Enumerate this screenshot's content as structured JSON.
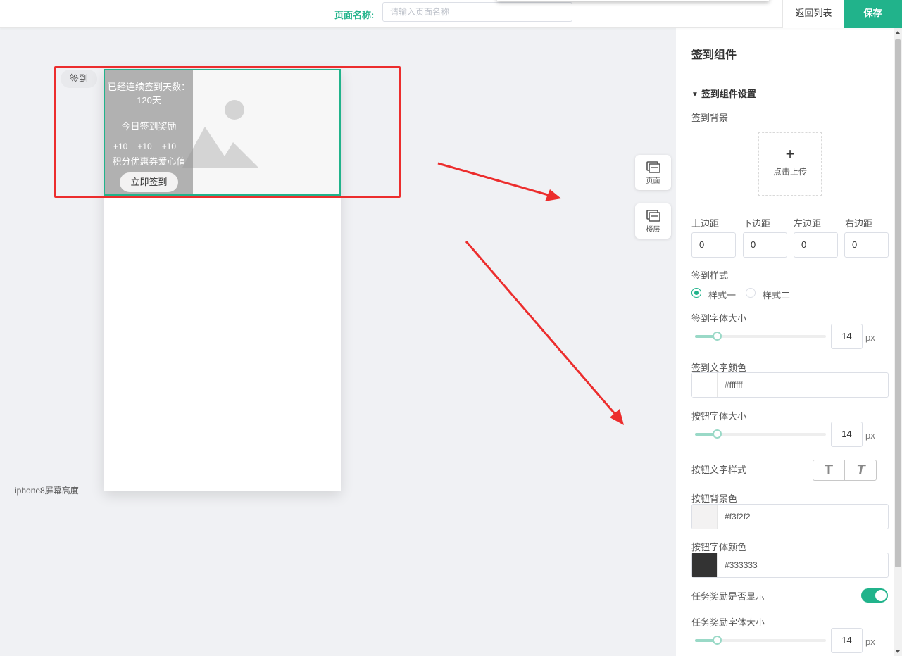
{
  "topbar": {
    "page_name_label": "页面名称:",
    "page_name_placeholder": "请输入页面名称",
    "back_label": "返回列表",
    "save_label": "保存"
  },
  "canvas": {
    "component_tag": "签到",
    "signin": {
      "days_text": "已经连续签到天数：120天",
      "today_reward": "今日签到奖励",
      "rewards": [
        "+10",
        "+10",
        "+10"
      ],
      "reward_names": "积分优惠券爱心值",
      "button_label": "立即签到"
    },
    "screen_height_label": "iphone8屏幕高度"
  },
  "side_tools": [
    {
      "label": "页面",
      "icon": "page-layers-icon"
    },
    {
      "label": "楼层",
      "icon": "floor-layers-icon"
    }
  ],
  "panel": {
    "title": "签到组件",
    "section_title": "签到组件设置",
    "bg_label": "签到背景",
    "upload_label": "点击上传",
    "margins": [
      {
        "label": "上边距",
        "value": "0"
      },
      {
        "label": "下边距",
        "value": "0"
      },
      {
        "label": "左边距",
        "value": "0"
      },
      {
        "label": "右边距",
        "value": "0"
      }
    ],
    "style_label": "签到样式",
    "style_options": [
      "样式一",
      "样式二"
    ],
    "style_selected": "样式一",
    "font_size_label": "签到字体大小",
    "font_size_value": "14",
    "unit": "px",
    "text_color_label": "签到文字颜色",
    "text_color_value": "#ffffff",
    "btn_font_size_label": "按钮字体大小",
    "btn_font_size_value": "14",
    "btn_text_style_label": "按钮文字样式",
    "btn_style_options": [
      "T",
      "T"
    ],
    "btn_bg_label": "按钮背景色",
    "btn_bg_value": "#f3f2f2",
    "btn_font_color_label": "按钮字体颜色",
    "btn_font_color_value": "#333333",
    "task_show_label": "任务奖励是否显示",
    "task_show_on": true,
    "task_font_size_label": "任务奖励字体大小",
    "task_font_size_value": "14"
  },
  "colors": {
    "accent": "#21b38b",
    "highlight_box": "#ec2d2d",
    "slider": "#9ad9c7"
  }
}
